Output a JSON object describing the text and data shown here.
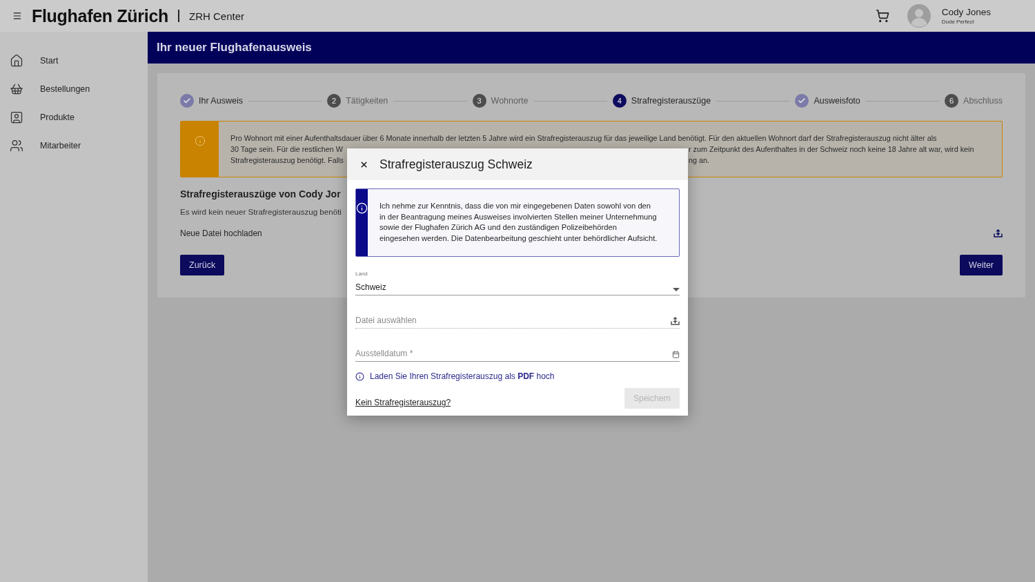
{
  "header": {
    "brand": "Flughafen Zürich",
    "app": "ZRH Center",
    "user": {
      "name": "Cody Jones",
      "subtitle": "Dude Perfect"
    }
  },
  "sidebar": {
    "items": [
      {
        "label": "Start",
        "selected": false
      },
      {
        "label": "Bestellungen",
        "selected": false
      },
      {
        "label": "Produkte",
        "selected": false
      },
      {
        "label": "Mitarbeiter",
        "selected": false
      }
    ]
  },
  "page_title": "Ihr neuer Flughafenausweis",
  "stepper": [
    {
      "label": "Ihr Ausweis",
      "kind": "done"
    },
    {
      "label": "Tätigkeiten",
      "kind": "todo",
      "number": "2"
    },
    {
      "label": "Wohnorte",
      "kind": "todo",
      "number": "3"
    },
    {
      "label": "Strafregisterauszüge",
      "kind": "current",
      "number": "4"
    },
    {
      "label": "Ausweisfoto",
      "kind": "done"
    },
    {
      "label": "Abschluss",
      "kind": "todo",
      "number": "6"
    }
  ],
  "notice": {
    "lines": [
      {
        "left": "Pro Wohnort mit einer Aufenthaltsdauer über 6 Monate innerhalb der letzten 5 Jahre wird ein Strafregisterauszug für das jeweilige Land benötigt. Für den aktuellen Wohnort darf der Strafregisterauszug nicht älter als"
      },
      {
        "left": "30 Tage sein. Für die restlichen W",
        "right": "r zum Zeitpunkt des Aufenthaltes in der Schweiz noch keine 18 Jahre alt war, wird kein"
      },
      {
        "left": "Strafregisterauszug benötigt. Falls",
        "right": "ng an."
      }
    ]
  },
  "section_title": "Strafregisterauszüge von Cody Jor",
  "section_text": "Es wird kein neuer Strafregisterauszug benöti",
  "upload_label": "Neue Datei hochladen",
  "buttons": {
    "back": "Zurück",
    "next": "Weiter"
  },
  "dialog": {
    "title": "Strafregisterauszug Schweiz",
    "info": "Ich nehme zur Kenntnis, dass die von mir eingegebenen Daten sowohl von den in der Beantragung meines Ausweises involvierten Stellen meiner Unternehmung sowie der Flughafen Zürich AG und den zuständigen Polizeibehörden eingesehen werden. Die Datenbearbeitung geschieht unter behördlicher Aufsicht.",
    "fields": [
      {
        "kind": "select",
        "label": "Land",
        "value": "Schweiz"
      },
      {
        "kind": "file",
        "placeholder": "Datei auswählen"
      },
      {
        "kind": "date",
        "placeholder": "Ausstelldatum *"
      }
    ],
    "hint": "Laden Sie Ihren Strafregisterauszug als **PDF** hoch",
    "link": "Kein Strafregisterauszug?",
    "save": {
      "label": "Speichern",
      "disabled": true
    }
  }
}
